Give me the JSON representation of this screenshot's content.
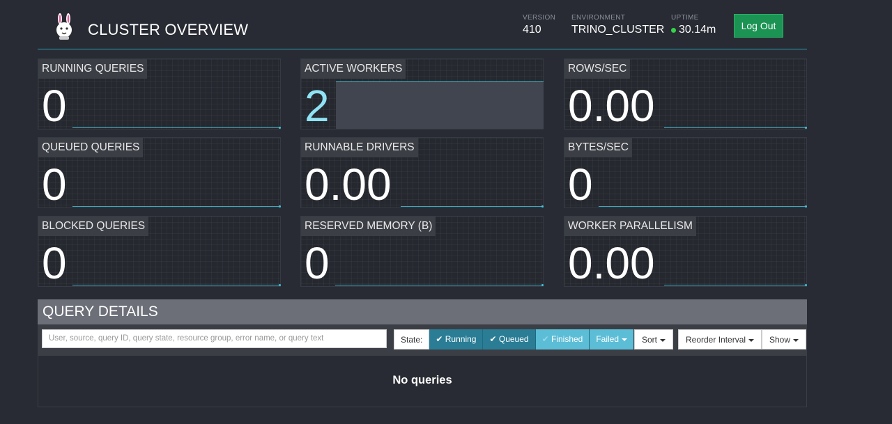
{
  "header": {
    "title": "CLUSTER OVERVIEW",
    "version_label": "VERSION",
    "version": "410",
    "environment_label": "ENVIRONMENT",
    "environment": "TRINO_CLUSTER",
    "uptime_label": "UPTIME",
    "uptime": "30.14m",
    "logout_label": "Log Out"
  },
  "stats": {
    "running_queries": {
      "label": "RUNNING QUERIES",
      "value": "0"
    },
    "active_workers": {
      "label": "ACTIVE WORKERS",
      "value": "2"
    },
    "rows_sec": {
      "label": "ROWS/SEC",
      "value": "0.00"
    },
    "queued_queries": {
      "label": "QUEUED QUERIES",
      "value": "0"
    },
    "runnable_drivers": {
      "label": "RUNNABLE DRIVERS",
      "value": "0.00"
    },
    "bytes_sec": {
      "label": "BYTES/SEC",
      "value": "0"
    },
    "blocked_queries": {
      "label": "BLOCKED QUERIES",
      "value": "0"
    },
    "reserved_memory": {
      "label": "RESERVED MEMORY (B)",
      "value": "0"
    },
    "worker_parallelism": {
      "label": "WORKER PARALLELISM",
      "value": "0.00"
    }
  },
  "query_details": {
    "title": "QUERY DETAILS",
    "search_placeholder": "User, source, query ID, query state, resource group, error name, or query text",
    "state_label": "State:",
    "states": {
      "running": "Running",
      "queued": "Queued",
      "finished": "Finished",
      "failed": "Failed"
    },
    "sort_label": "Sort",
    "reorder_label": "Reorder Interval",
    "show_label": "Show",
    "empty_text": "No queries"
  },
  "colors": {
    "background": "#282b33",
    "accent": "#27a3bd",
    "logout": "#1b9353",
    "uptime_dot": "#35d24a"
  }
}
